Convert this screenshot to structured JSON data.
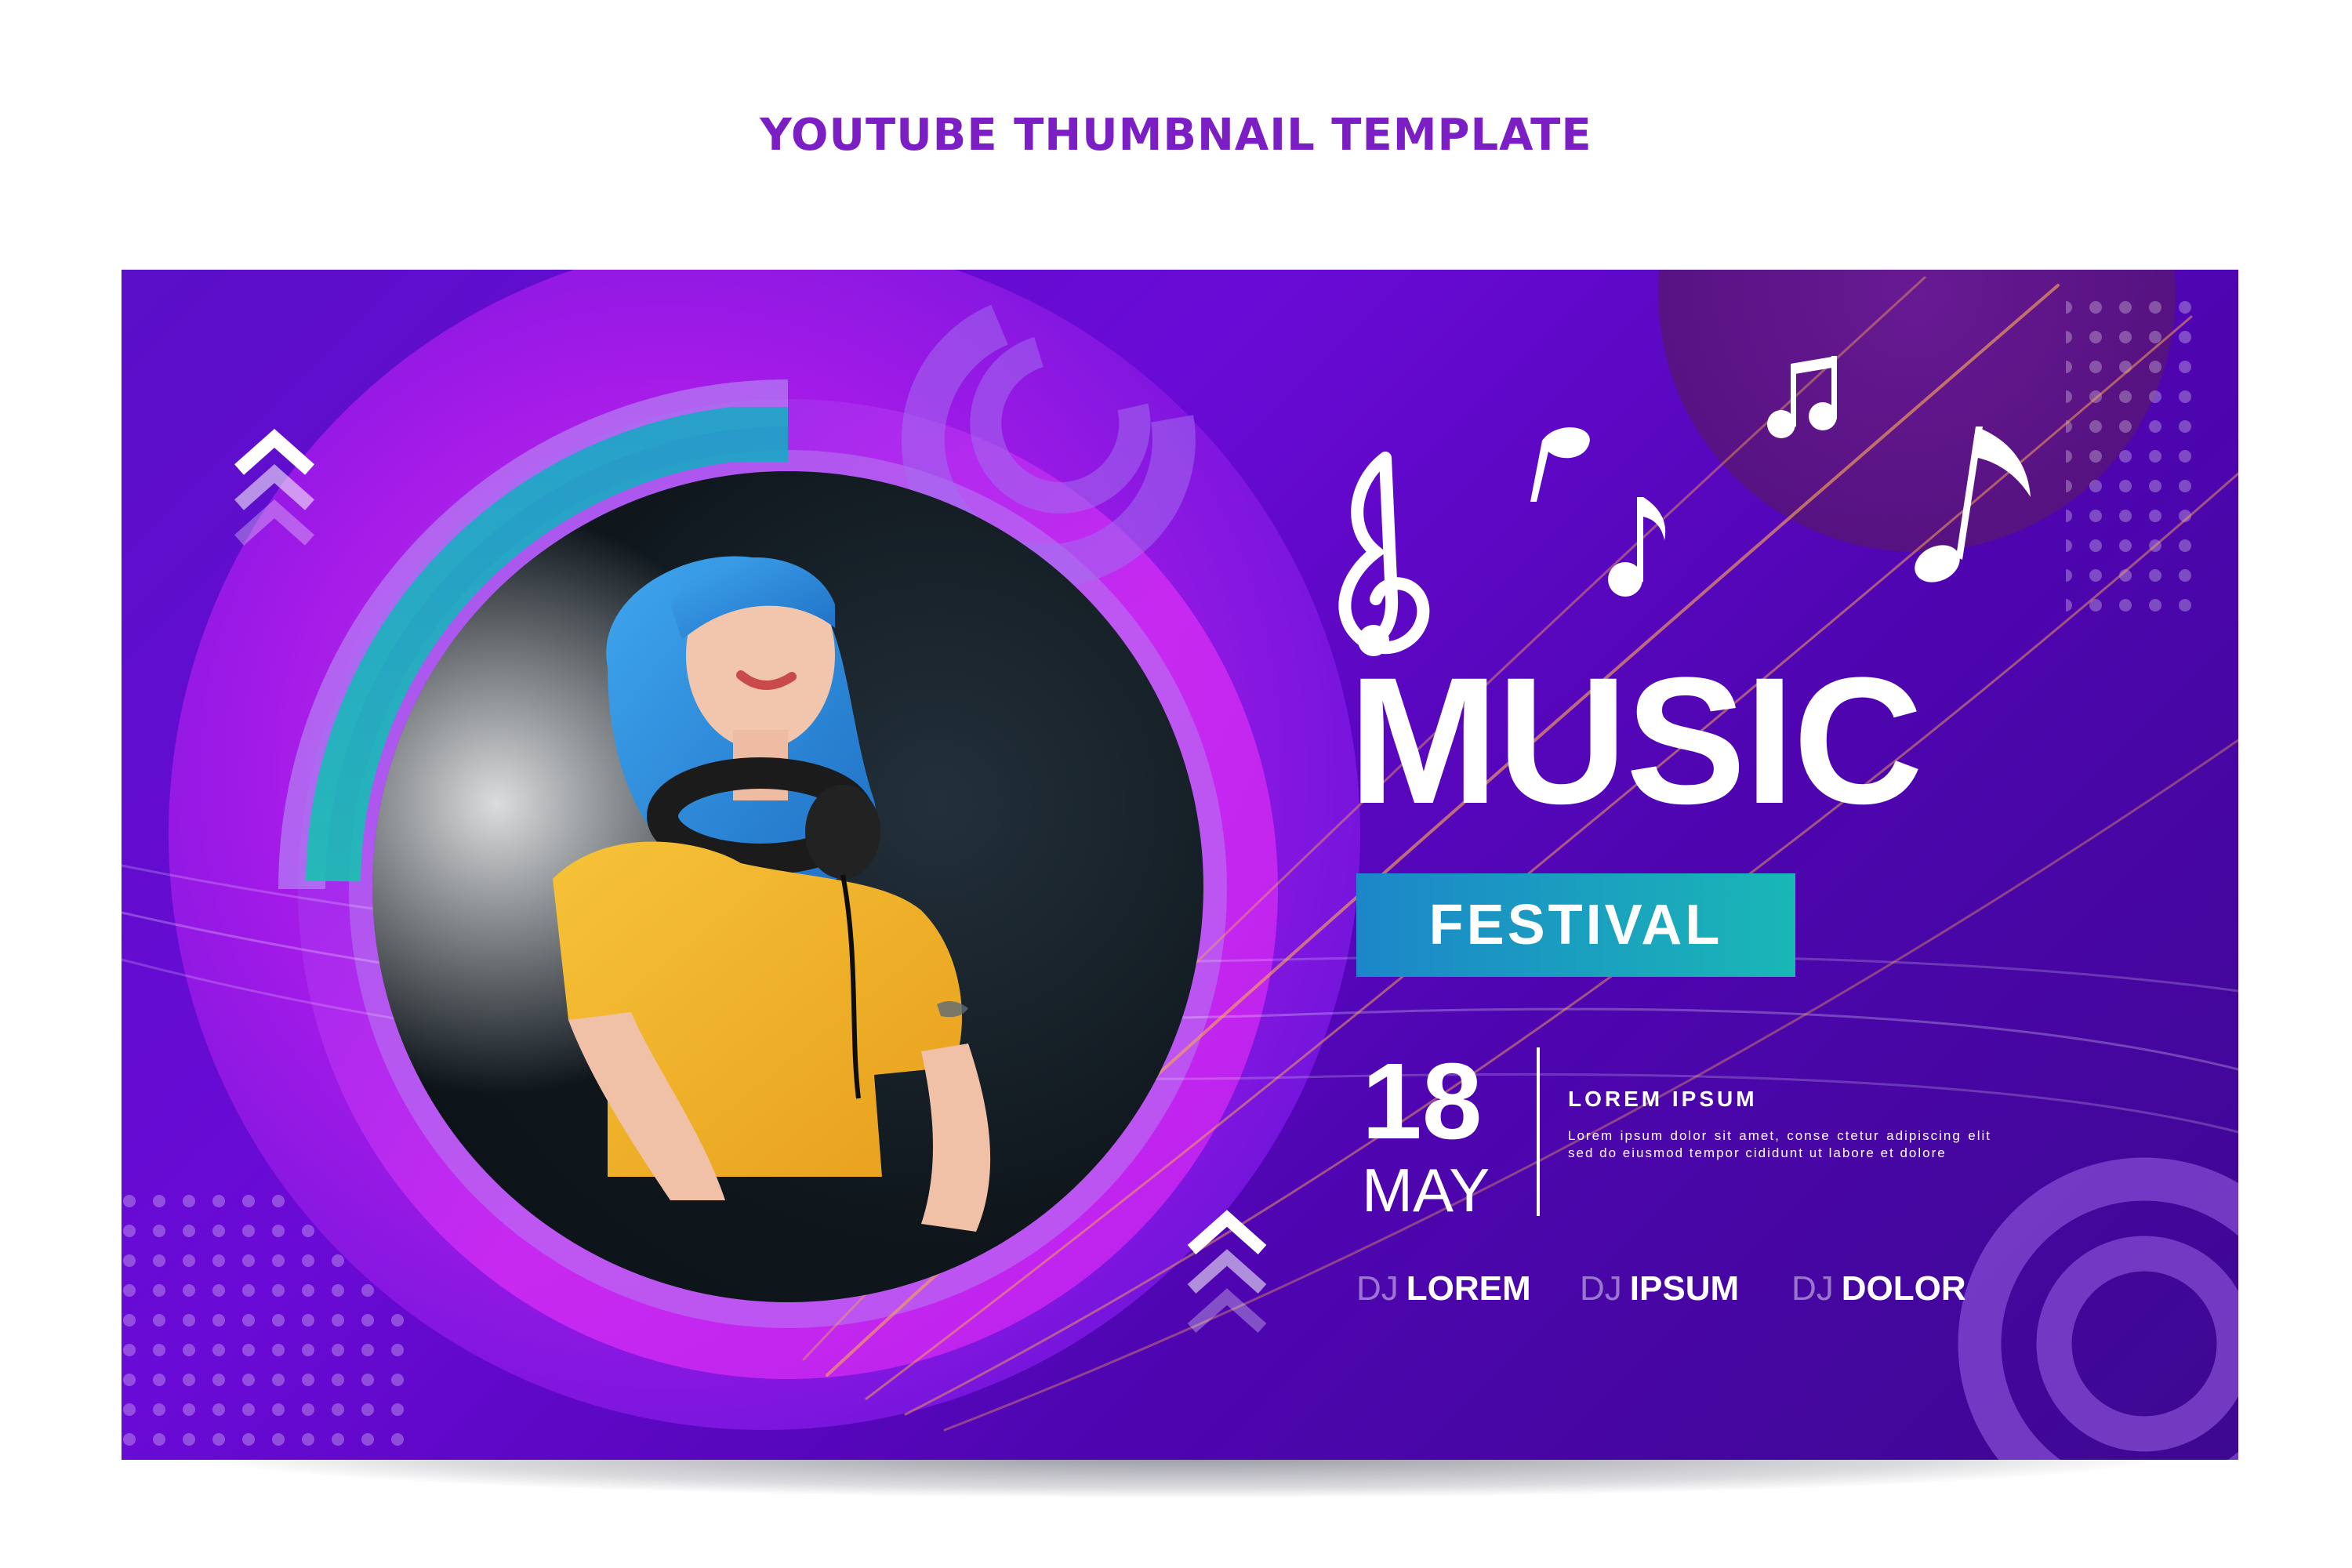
{
  "page_header": "YOUTUBE THUMBNAIL TEMPLATE",
  "banner": {
    "headline": "MUSIC",
    "subheadline": "FESTIVAL",
    "date": {
      "day": "18",
      "month": "MAY"
    },
    "info": {
      "title": "LOREM IPSUM",
      "body": "Lorem ipsum dolor sit amet, conse ctetur adipiscing elit sed do eiusmod tempor cididunt ut labore et dolore"
    },
    "lineup": [
      {
        "prefix": "DJ",
        "name": "LOREM"
      },
      {
        "prefix": "DJ",
        "name": "IPSUM"
      },
      {
        "prefix": "DJ",
        "name": "DOLOR"
      }
    ],
    "icons": [
      "treble-clef-icon",
      "eighth-note-icon",
      "beamed-notes-icon",
      "double-chevron-up-icon"
    ]
  },
  "colors": {
    "header_text": "#7b1fc4",
    "banner_purple": "#5a0fc8",
    "banner_magenta": "#c41ff0",
    "accent_teal": "#19b7b6",
    "accent_blue": "#1c86c9",
    "hair_blue": "#2e8fe0",
    "shirt_yellow": "#f3b628"
  }
}
